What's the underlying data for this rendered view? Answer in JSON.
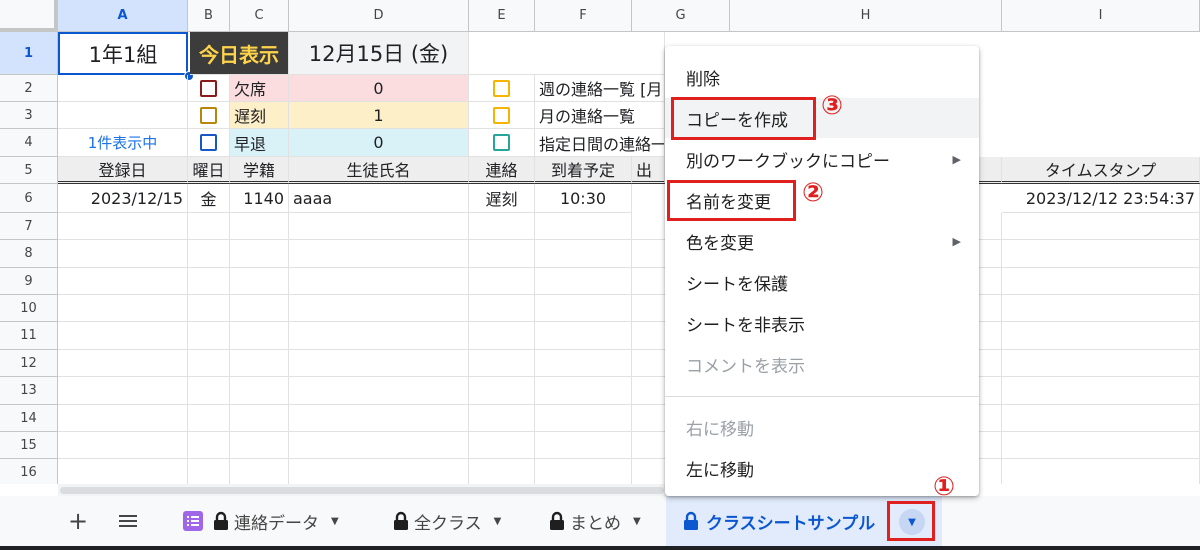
{
  "columns": [
    "A",
    "B",
    "C",
    "D",
    "E",
    "F",
    "G",
    "H",
    "I"
  ],
  "rows": [
    "1",
    "2",
    "3",
    "4",
    "5",
    "6",
    "7",
    "8",
    "9",
    "10",
    "11",
    "12",
    "13",
    "14",
    "15",
    "16"
  ],
  "row1": {
    "class_name": "1年1組",
    "today_button": "今日表示",
    "date": "12月15日 (金)"
  },
  "status_rows": [
    {
      "label": "欠席",
      "count": "0",
      "report": "週の連絡一覧 [月"
    },
    {
      "label": "遅刻",
      "count": "1",
      "report": "月の連絡一覧"
    },
    {
      "label": "早退",
      "count": "0",
      "report": "指定日間の連絡一"
    }
  ],
  "row4_note": "1件表示中",
  "headers": {
    "date": "登録日",
    "weekday": "曜日",
    "student_no": "学籍",
    "student_name": "生徒氏名",
    "contact": "連絡",
    "arrival": "到着予定",
    "partial": "出",
    "timestamp": "タイムスタンプ"
  },
  "record": {
    "date": "2023/12/15",
    "weekday": "金",
    "student_no": "1140",
    "student_name": "aaaa",
    "contact": "遅刻",
    "arrival": "10:30",
    "timestamp": "2023/12/12 23:54:37"
  },
  "menu": [
    {
      "label": "削除"
    },
    {
      "label": "コピーを作成"
    },
    {
      "label": "別のワークブックにコピー"
    },
    {
      "label": "名前を変更"
    },
    {
      "label": "色を変更"
    },
    {
      "label": "シートを保護"
    },
    {
      "label": "シートを非表示"
    },
    {
      "label": "コメントを表示"
    },
    {
      "label": "右に移動"
    },
    {
      "label": "左に移動"
    }
  ],
  "annotations": {
    "step1": "①",
    "step2": "②",
    "step3": "③"
  },
  "tabs": [
    {
      "label": "連絡データ",
      "underline": "#8430ce"
    },
    {
      "label": "全クラス",
      "underline": "#ff00ff"
    },
    {
      "label": "まとめ",
      "underline": "#00ff00"
    },
    {
      "label": "クラスシートサンプル"
    }
  ],
  "colors": {
    "accent": "#0b57d0",
    "annotation_red": "#e0201f",
    "absent_bg": "#fbdde0",
    "late_bg": "#fdefc8",
    "early_bg": "#d8f2f8",
    "today_btn_bg": "#3c3c3c",
    "today_btn_fg": "#ffd44a"
  },
  "icons": {
    "add": "plus-icon",
    "all_sheets": "menu-icon",
    "form": "form-icon",
    "lock": "lock-icon",
    "dropdown": "caret-down-icon"
  }
}
